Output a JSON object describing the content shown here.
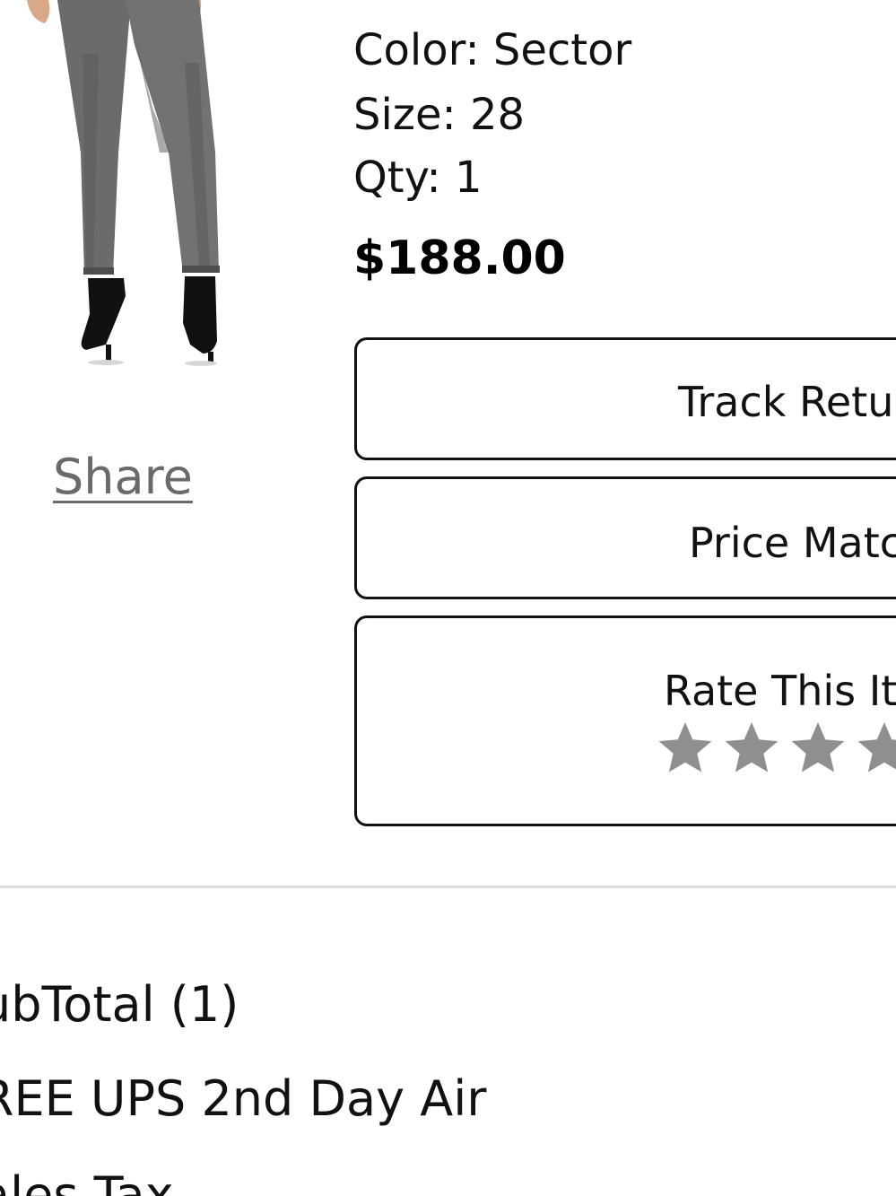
{
  "product": {
    "color": "Color: Sector",
    "size": "Size: 28",
    "qty": "Qty: 1",
    "price": "$188.00",
    "share_label": "Share"
  },
  "actions": {
    "track_label": "Track Retu",
    "price_match_label": "Price Matc",
    "rate_label": "Rate This It",
    "star_color": "#8f8f8f"
  },
  "summary": {
    "subtotal_label": "ubTotal (1)",
    "shipping_label": "REE UPS 2nd Day Air",
    "tax_label": "ales Tax"
  }
}
